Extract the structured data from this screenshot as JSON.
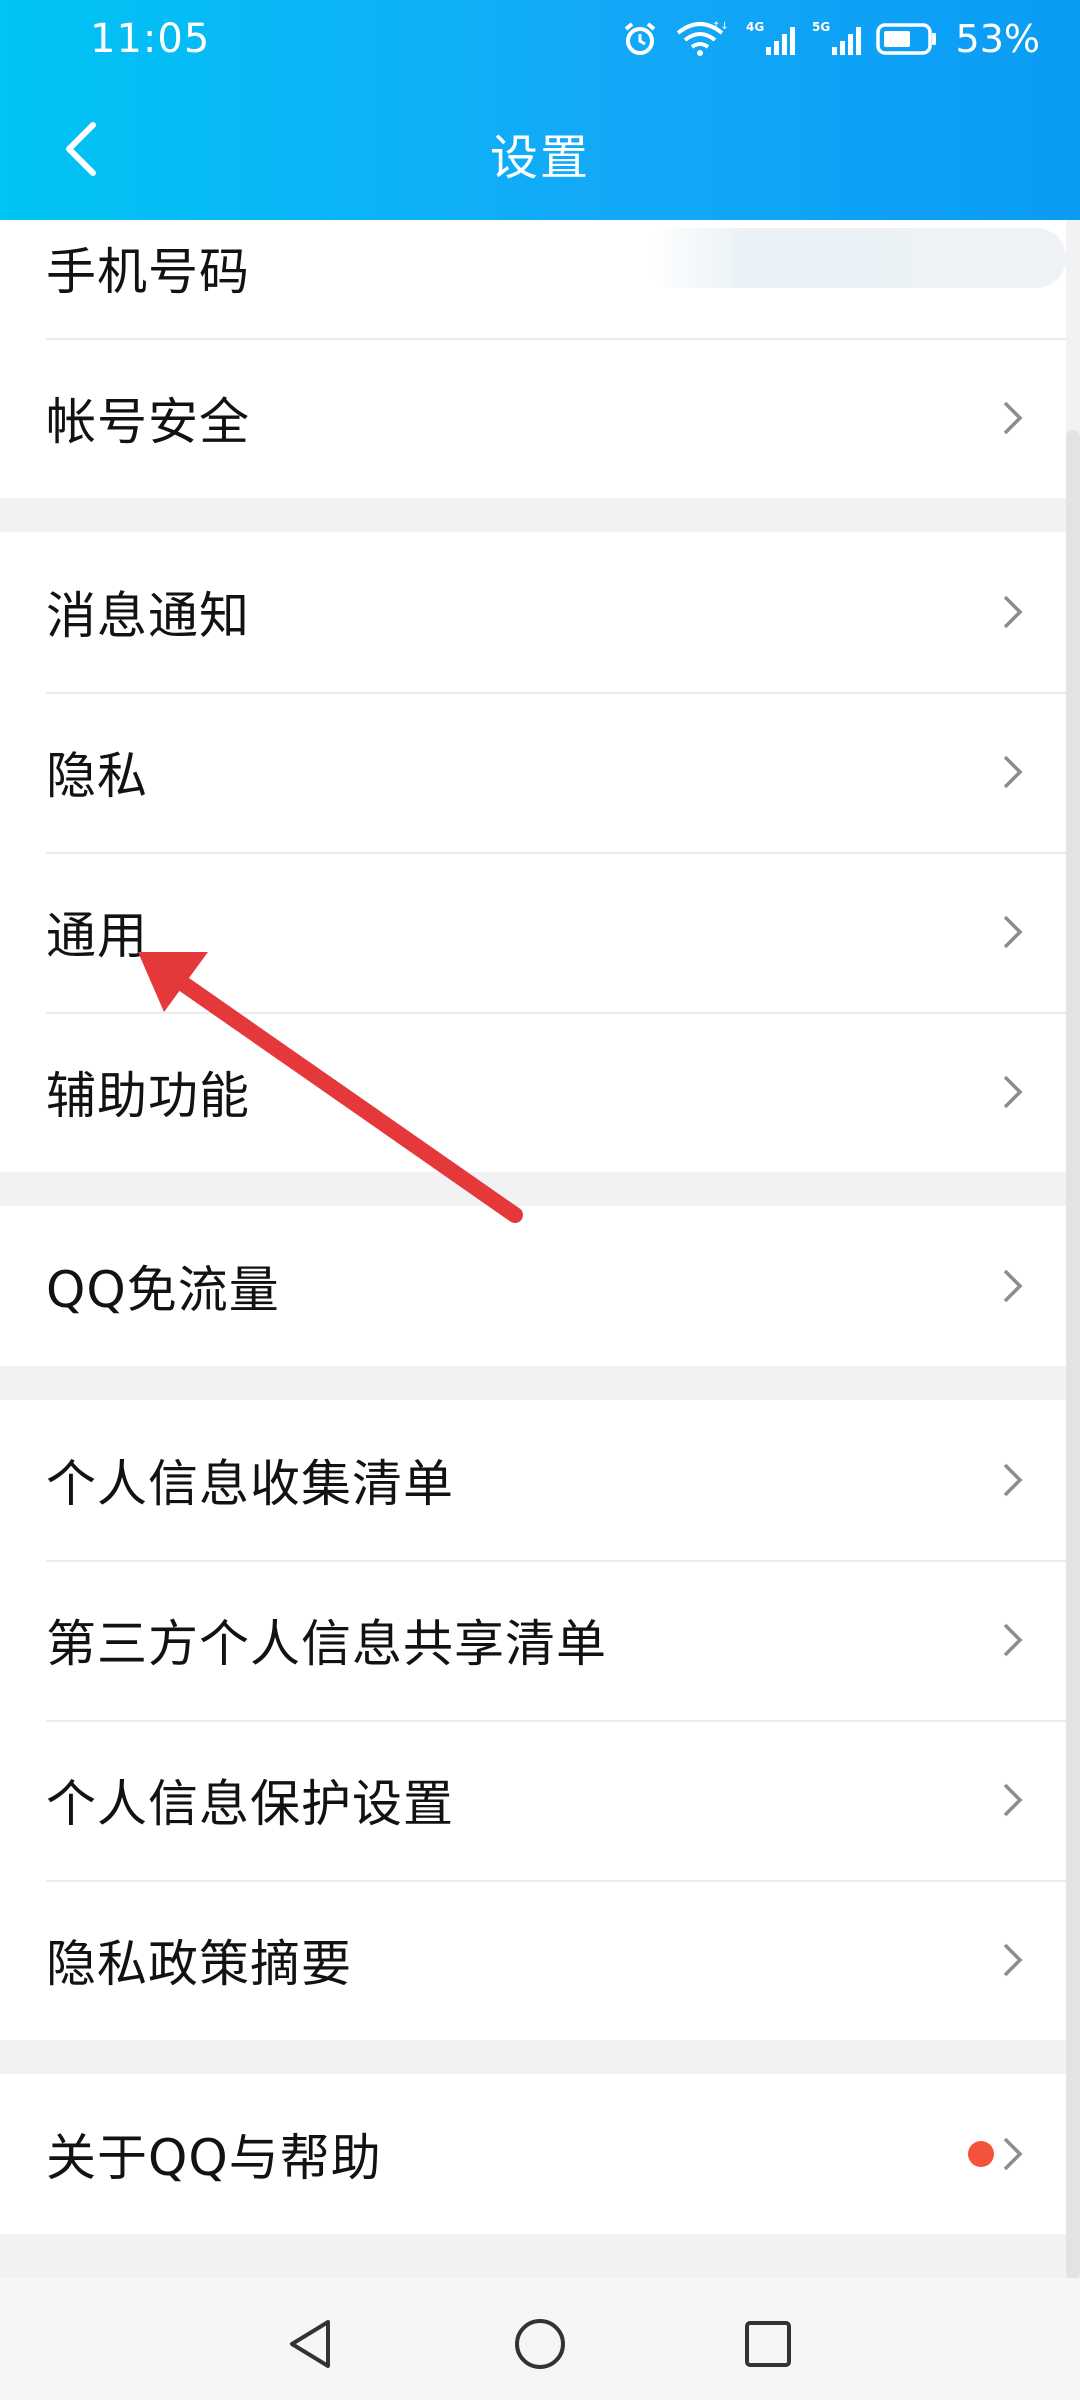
{
  "status": {
    "time": "11:05",
    "battery": "53%",
    "icons": [
      "alarm-icon",
      "wifi-icon",
      "signal-4g-icon",
      "signal-5g-icon",
      "battery-icon"
    ]
  },
  "header": {
    "title": "设置",
    "back_icon": "chevron-left-icon"
  },
  "groups": [
    {
      "items": [
        {
          "label": "手机号码",
          "icon": "chevron-right-icon",
          "value_masked": true
        },
        {
          "label": "帐号安全",
          "icon": "chevron-right-icon"
        }
      ]
    },
    {
      "items": [
        {
          "label": "消息通知",
          "icon": "chevron-right-icon"
        },
        {
          "label": "隐私",
          "icon": "chevron-right-icon"
        },
        {
          "label": "通用",
          "icon": "chevron-right-icon"
        },
        {
          "label": "辅助功能",
          "icon": "chevron-right-icon"
        }
      ]
    },
    {
      "items": [
        {
          "label": "QQ免流量",
          "icon": "chevron-right-icon"
        }
      ]
    },
    {
      "items": [
        {
          "label": "个人信息收集清单",
          "icon": "chevron-right-icon"
        },
        {
          "label": "第三方个人信息共享清单",
          "icon": "chevron-right-icon"
        },
        {
          "label": "个人信息保护设置",
          "icon": "chevron-right-icon"
        },
        {
          "label": "隐私政策摘要",
          "icon": "chevron-right-icon"
        }
      ]
    },
    {
      "items": [
        {
          "label": "关于QQ与帮助",
          "icon": "chevron-right-icon",
          "badge": "red-dot"
        }
      ]
    }
  ],
  "annotation": {
    "type": "arrow",
    "points_to": "通用",
    "color": "#e5383b"
  },
  "system_nav": [
    "back-triangle-icon",
    "home-circle-icon",
    "recents-square-icon"
  ],
  "colors": {
    "header_start": "#00c4f4",
    "header_end": "#0a9cf5",
    "badge": "#f2533a"
  }
}
